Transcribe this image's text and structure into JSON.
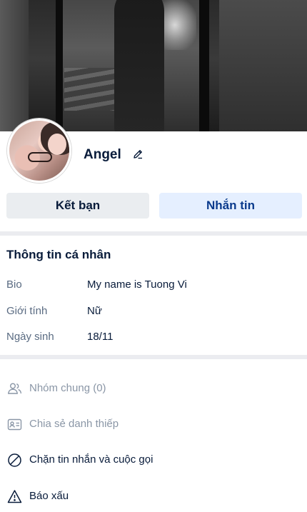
{
  "profile": {
    "name": "Angel"
  },
  "actions": {
    "add_friend_label": "Kết bạn",
    "message_label": "Nhắn tin"
  },
  "info": {
    "title": "Thông tin cá nhân",
    "rows": [
      {
        "label": "Bio",
        "value": "My name is Tuong Vi"
      },
      {
        "label": "Giới tính",
        "value": "Nữ"
      },
      {
        "label": "Ngày sinh",
        "value": "18/11"
      }
    ]
  },
  "menu": {
    "items": [
      {
        "label": "Nhóm chung (0)",
        "icon": "group-icon",
        "disabled": true
      },
      {
        "label": "Chia sẻ danh thiếp",
        "icon": "contact-card-icon",
        "disabled": true
      },
      {
        "label": "Chặn tin nhắn và cuộc gọi",
        "icon": "block-icon",
        "disabled": false
      },
      {
        "label": "Báo xấu",
        "icon": "warning-icon",
        "disabled": false
      }
    ]
  },
  "colors": {
    "primary_text": "#081b3a",
    "secondary_text": "#5a6b82",
    "disabled_text": "#8a96a6",
    "message_button_bg": "#e5efff",
    "message_button_text": "#0a3a8c",
    "friend_button_bg": "#eaedf0",
    "divider": "#ebecf0"
  }
}
